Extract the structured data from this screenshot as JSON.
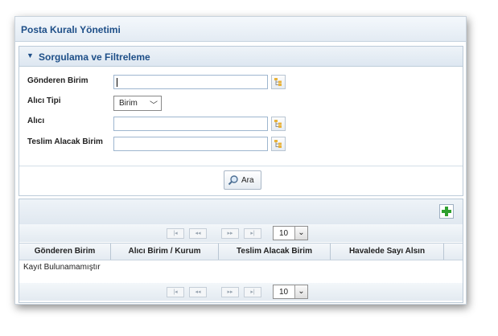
{
  "window": {
    "title": "Posta Kuralı Yönetimi"
  },
  "filter_panel": {
    "title": "Sorgulama ve Filtreleme",
    "fields": {
      "gonderen_birim": {
        "label": "Gönderen Birim",
        "value": ""
      },
      "alici_tipi": {
        "label": "Alıcı Tipi",
        "selected": "Birim"
      },
      "alici": {
        "label": "Alıcı",
        "value": ""
      },
      "teslim_alacak_birim": {
        "label": "Teslim Alacak Birim",
        "value": ""
      }
    },
    "search_button": "Ara"
  },
  "grid": {
    "page_size": "10",
    "columns": [
      "Gönderen Birim",
      "Alıcı Birim / Kurum",
      "Teslim Alacak Birim",
      "Havalede Sayı Alsın"
    ],
    "empty_message": "Kayıt Bulunamamıştır",
    "pager_icons": [
      "first-page-icon",
      "prev-page-icon",
      "next-page-icon",
      "last-page-icon"
    ]
  },
  "colors": {
    "accent": "#1e4f88",
    "add": "#2fa02f"
  }
}
